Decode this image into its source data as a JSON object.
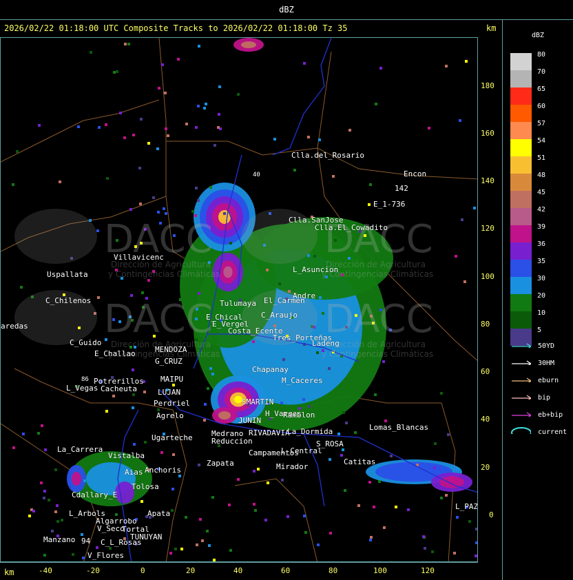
{
  "header": {
    "title": "dBZ"
  },
  "subtitle": "2026/02/22 01:18:00 UTC Composite Tracks to 2026/02/22 01:18:00 Tz 35",
  "axis_units": {
    "y_unit": "km",
    "x_unit": "km"
  },
  "y_ticks": [
    "180",
    "160",
    "140",
    "120",
    "100",
    "80",
    "60",
    "40",
    "20",
    "0"
  ],
  "x_ticks": [
    "-40",
    "-20",
    "0",
    "20",
    "40",
    "60",
    "80",
    "100",
    "120"
  ],
  "legend": {
    "title": "dBZ",
    "levels": [
      {
        "label": "80",
        "color": "#d2d2d2"
      },
      {
        "label": "70",
        "color": "#b4b4b4"
      },
      {
        "label": "65",
        "color": "#ff2a18"
      },
      {
        "label": "60",
        "color": "#ff5a00"
      },
      {
        "label": "57",
        "color": "#ff8a50"
      },
      {
        "label": "54",
        "color": "#ffff00"
      },
      {
        "label": "51",
        "color": "#f8c030"
      },
      {
        "label": "48",
        "color": "#d88a3a"
      },
      {
        "label": "45",
        "color": "#c07060"
      },
      {
        "label": "42",
        "color": "#b85a8a"
      },
      {
        "label": "39",
        "color": "#c0128a"
      },
      {
        "label": "36",
        "color": "#7820d0"
      },
      {
        "label": "35",
        "color": "#2a50e8"
      },
      {
        "label": "30",
        "color": "#1a90e0"
      },
      {
        "label": "20",
        "color": "#127a12"
      },
      {
        "label": "10",
        "color": "#0a5a0a"
      },
      {
        "label": "5",
        "color": "#4a3a8a"
      }
    ]
  },
  "tracks": [
    {
      "label": "50YD",
      "color": "#40e0e0"
    },
    {
      "label": "30HM",
      "color": "#ffffff"
    },
    {
      "label": "eburn",
      "color": "#f0c080"
    },
    {
      "label": "bip",
      "color": "#ffc0c0"
    },
    {
      "label": "eb+bip",
      "color": "#e040e0"
    },
    {
      "label": "current",
      "color": "#40e0e0"
    }
  ],
  "watermark": {
    "brand": "DACC",
    "line1": "Dirección de Agricultura",
    "line2": "y Contingencias Climáticas"
  },
  "places": [
    {
      "name": "Clla.del_Rosario"
    },
    {
      "name": "Encon"
    },
    {
      "name": "142"
    },
    {
      "name": "E_1-736"
    },
    {
      "name": "Clla.SanJose"
    },
    {
      "name": "Clla.El_Cowadito"
    },
    {
      "name": "Villavicenc"
    },
    {
      "name": "Uspallata"
    },
    {
      "name": "L_Asuncion"
    },
    {
      "name": "C_Chilenos"
    },
    {
      "name": "Tulumaya"
    },
    {
      "name": "El_Carmen"
    },
    {
      "name": "Andre"
    },
    {
      "name": "E_Chical"
    },
    {
      "name": "E_Vergel"
    },
    {
      "name": "C_Araujo"
    },
    {
      "name": "aredas"
    },
    {
      "name": "Costa_Ecente"
    },
    {
      "name": "C_Guido"
    },
    {
      "name": "E_Challao"
    },
    {
      "name": "Tres_Porteñas"
    },
    {
      "name": "Ladeng"
    },
    {
      "name": "MENDOZA"
    },
    {
      "name": "G_CRUZ"
    },
    {
      "name": "Potrerillos"
    },
    {
      "name": "Cacheuta"
    },
    {
      "name": "L_Vegas"
    },
    {
      "name": "MAIPU"
    },
    {
      "name": "Chapanay"
    },
    {
      "name": "M_Caceres"
    },
    {
      "name": "LUJAN"
    },
    {
      "name": "Perdriel"
    },
    {
      "name": "SMARTIN"
    },
    {
      "name": "Agrelo"
    },
    {
      "name": "JUNIN"
    },
    {
      "name": "H_Vargas"
    },
    {
      "name": "Ramblon"
    },
    {
      "name": "Ugarteche"
    },
    {
      "name": "RIVADAVIA"
    },
    {
      "name": "La_Dormida"
    },
    {
      "name": "Medrano"
    },
    {
      "name": "Reduccion"
    },
    {
      "name": "Lomas_Blancas"
    },
    {
      "name": "S_ROSA"
    },
    {
      "name": "La_Carrera"
    },
    {
      "name": "Campamentos"
    },
    {
      "name": "L_Central"
    },
    {
      "name": "Catitas"
    },
    {
      "name": "Anchoris"
    },
    {
      "name": "Zapata"
    },
    {
      "name": "Mirador"
    },
    {
      "name": "Vistalba"
    },
    {
      "name": "Aias"
    },
    {
      "name": "Tolosa"
    },
    {
      "name": "Cdallary_E"
    },
    {
      "name": "L_Arbols"
    },
    {
      "name": "Apata"
    },
    {
      "name": "Algarrobo"
    },
    {
      "name": "V_Seco"
    },
    {
      "name": "Tortal"
    },
    {
      "name": "TUNUYAN"
    },
    {
      "name": "Manzano"
    },
    {
      "name": "94"
    },
    {
      "name": "C_L_Rosas"
    },
    {
      "name": "V_Flores"
    },
    {
      "name": "L_PAZ"
    },
    {
      "name": "86"
    },
    {
      "name": "40"
    }
  ]
}
